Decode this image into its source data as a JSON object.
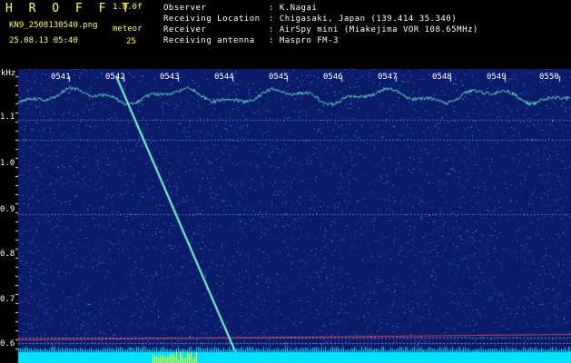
{
  "header": {
    "app_name": "H R O F F T",
    "version": "1.0.0f",
    "filename": "KN9_2508130540.png",
    "datetime": "25.08.13 05:40",
    "meteor_label": "meteor",
    "meteor_count": "25",
    "info": [
      {
        "label": "Observer",
        "value": ": K.Nagai"
      },
      {
        "label": "Receiving Location",
        "value": ": Chigasaki, Japan (139.414 35.340)"
      },
      {
        "label": "Receiver",
        "value": ": AirSpy mini (Miakejima VOR 108.65MHz)"
      },
      {
        "label": "Receiving antenna",
        "value": ": Maspro FM-3"
      }
    ]
  },
  "spectrogram": {
    "y_unit": "kHz",
    "y_ticks": [
      "1.1",
      "1.0",
      "0.9",
      "0.8",
      "0.7",
      "0.6"
    ],
    "x_ticks": [
      "0541",
      "0542",
      "0543",
      "0544",
      "0545",
      "0546",
      "0547",
      "0548",
      "0549",
      "0550"
    ],
    "colors": {
      "background": "#0a1a66",
      "noise_low": "#1e3cc8",
      "noise_high": "#4a90ff",
      "trail": "#7cffd0",
      "bottom_band": "#00e0ff",
      "bottom_bright": "#ffff00"
    }
  }
}
